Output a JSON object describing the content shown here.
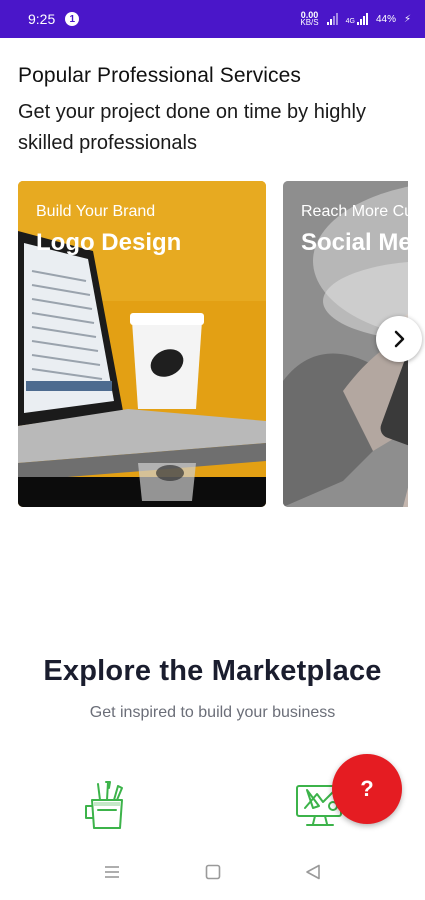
{
  "status_bar": {
    "time": "9:25",
    "notification_count": "1",
    "net_speed_value": "0.00",
    "net_speed_unit": "KB/S",
    "signal_label": "4G",
    "battery": "44%"
  },
  "services": {
    "title": "Popular Professional Services",
    "subtitle": "Get your project done on time by highly skilled professionals",
    "cards": [
      {
        "eyebrow": "Build Your Brand",
        "title": "Logo Design"
      },
      {
        "eyebrow": "Reach More Customers",
        "title": "Social Media"
      }
    ]
  },
  "marketplace": {
    "title": "Explore the Marketplace",
    "subtitle": "Get inspired to build your business"
  },
  "help_button": {
    "label": "?"
  },
  "colors": {
    "status_bar": "#4a16c9",
    "fab": "#e51c22",
    "category_icon": "#3cb34a"
  },
  "icons": [
    "chevron-right-icon",
    "graphics-design-icon",
    "digital-marketing-icon",
    "question-icon",
    "menu-icon",
    "home-square-icon",
    "back-triangle-icon"
  ]
}
